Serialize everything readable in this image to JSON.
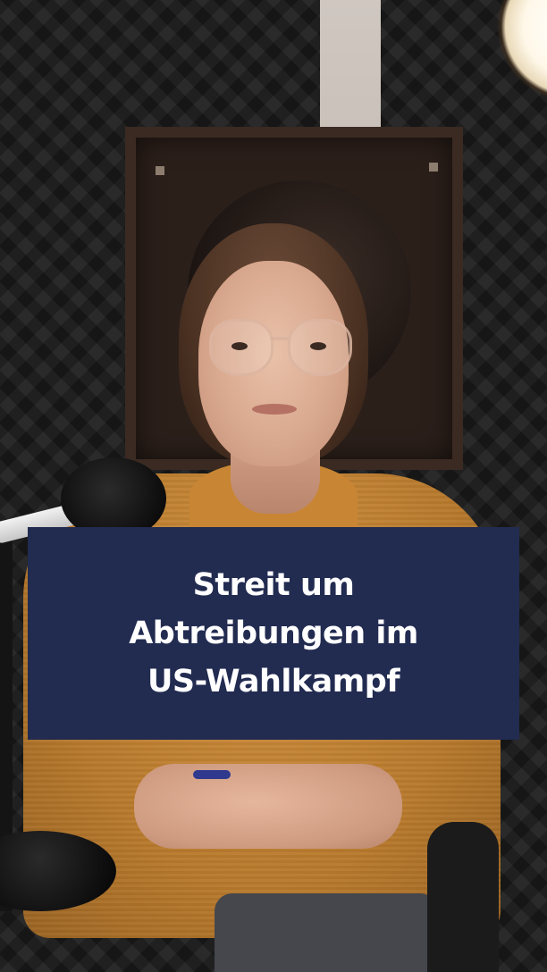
{
  "headline": {
    "lines": [
      "Streit um",
      "Abtreibungen im",
      "US-Wahlkampf"
    ]
  },
  "colors": {
    "card_background": "#222b50",
    "headline_text": "#ffffff",
    "shirt": "#b87a2d",
    "studio_wall": "#1c1c1c"
  }
}
